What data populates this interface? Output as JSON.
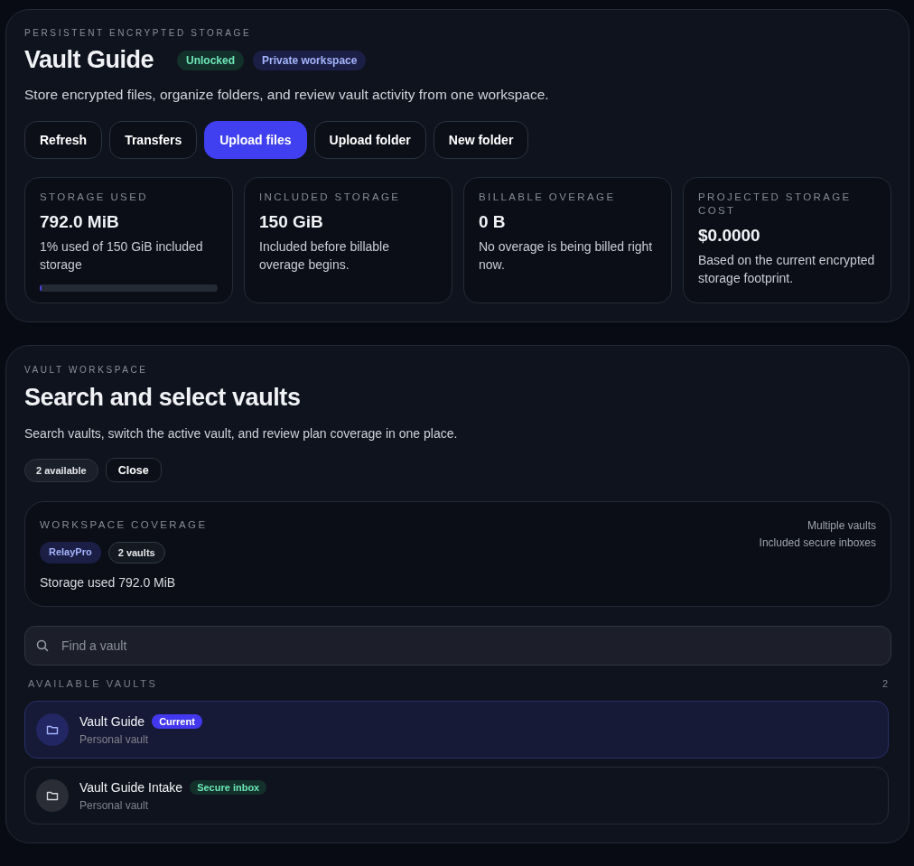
{
  "header": {
    "eyebrow": "PERSISTENT ENCRYPTED STORAGE",
    "title": "Vault Guide",
    "badges": [
      {
        "label": "Unlocked",
        "kind": "success"
      },
      {
        "label": "Private workspace",
        "kind": "accent"
      }
    ],
    "description": "Store encrypted files, organize folders, and review vault activity from one workspace.",
    "buttons": [
      {
        "label": "Refresh",
        "kind": "secondary"
      },
      {
        "label": "Transfers",
        "kind": "secondary"
      },
      {
        "label": "Upload files",
        "kind": "primary"
      },
      {
        "label": "Upload folder",
        "kind": "secondary"
      },
      {
        "label": "New folder",
        "kind": "secondary"
      }
    ],
    "stats": [
      {
        "label": "STORAGE USED",
        "value": "792.0 MiB",
        "note": "1% used of 150 GiB included storage",
        "level": 0.01
      },
      {
        "label": "INCLUDED STORAGE",
        "value": "150 GiB",
        "note": "Included before billable overage begins."
      },
      {
        "label": "BILLABLE OVERAGE",
        "value": "0 B",
        "note": "No overage is being billed right now."
      },
      {
        "label": "PROJECTED STORAGE COST",
        "value": "$0.0000",
        "note": "Based on the current encrypted storage footprint."
      }
    ]
  },
  "workspace": {
    "eyebrow": "VAULT WORKSPACE",
    "title": "Search and select vaults",
    "description": "Search vaults, switch the active vault, and review plan coverage in one place.",
    "count_chip": "2 available",
    "close_button": "Close",
    "coverage": {
      "eyebrow": "WORKSPACE COVERAGE",
      "chips": [
        {
          "label": "RelayPro",
          "kind": "accent"
        },
        {
          "label": "2 vaults",
          "kind": "neutral"
        }
      ],
      "storage": "Storage used 792.0 MiB",
      "features": [
        "Multiple vaults",
        "Included secure inboxes"
      ]
    },
    "search": {
      "placeholder": "Find a vault"
    },
    "list_label": "AVAILABLE VAULTS",
    "list_count": "2",
    "vaults": [
      {
        "name": "Vault Guide",
        "badge": {
          "label": "Current",
          "kind": "primary"
        },
        "subtitle": "Personal vault",
        "selected": true
      },
      {
        "name": "Vault Guide Intake",
        "badge": {
          "label": "Secure inbox",
          "kind": "success"
        },
        "subtitle": "Personal vault",
        "selected": false
      }
    ]
  }
}
